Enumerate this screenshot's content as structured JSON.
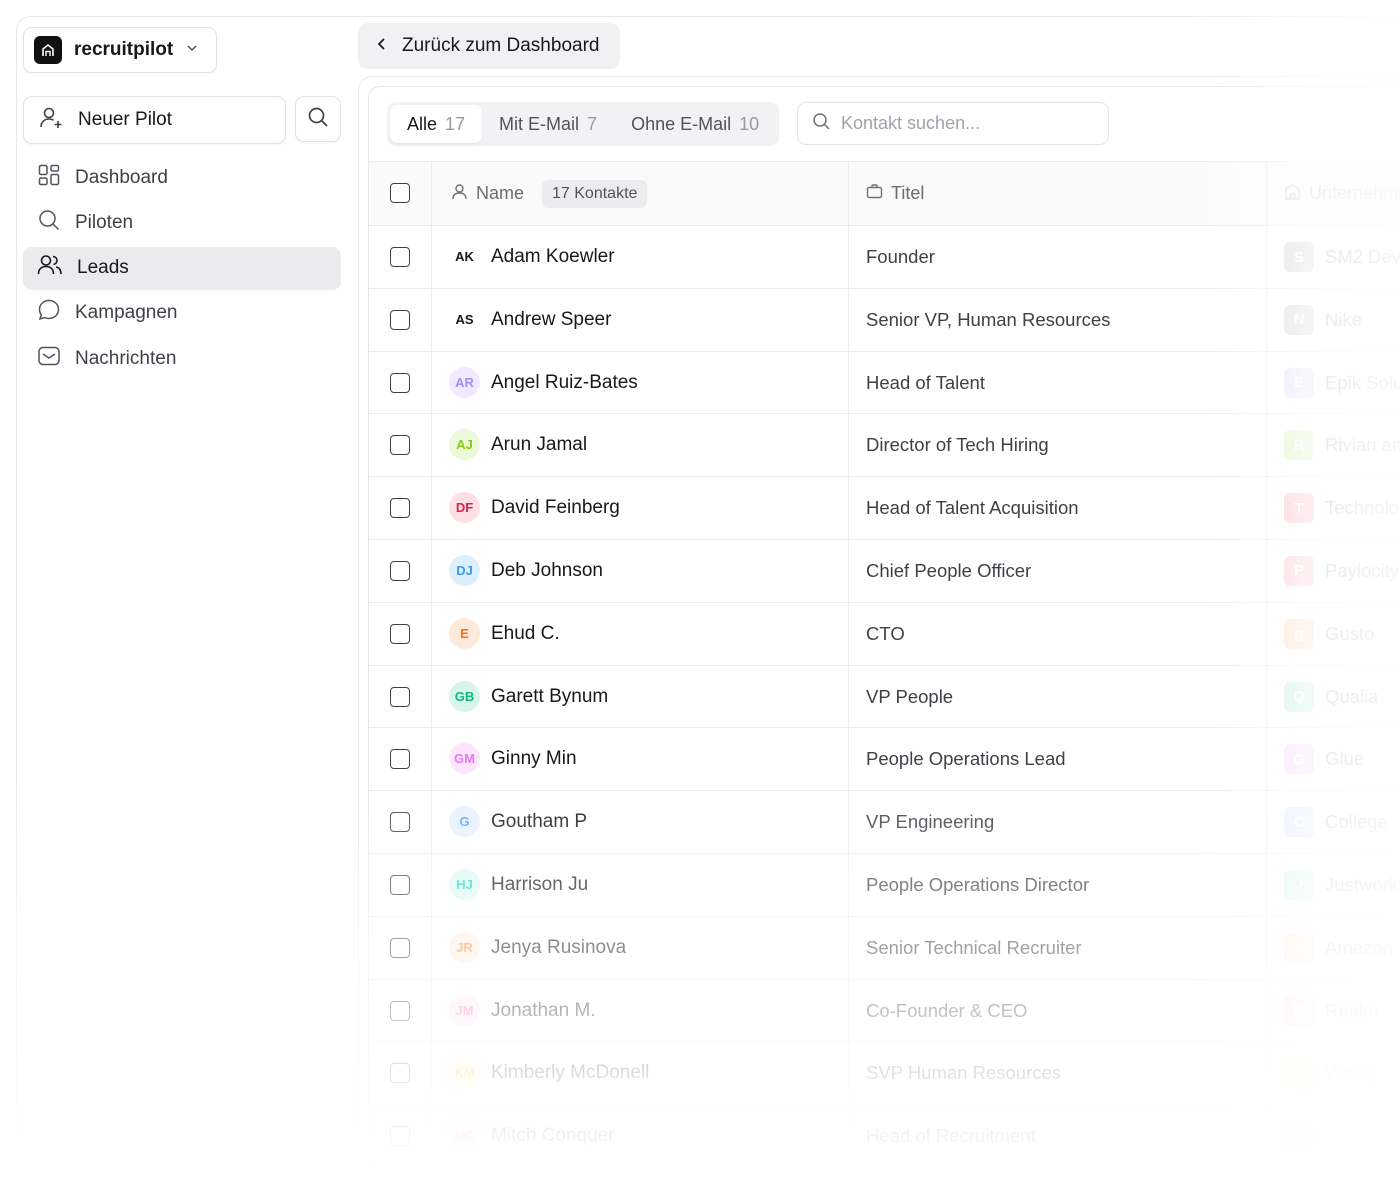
{
  "workspace": {
    "name": "recruitpilot"
  },
  "sidebar": {
    "new_pilot_label": "Neuer Pilot",
    "items": [
      {
        "label": "Dashboard",
        "icon": "grid-icon",
        "active": false
      },
      {
        "label": "Piloten",
        "icon": "search-icon",
        "active": false
      },
      {
        "label": "Leads",
        "icon": "users-icon",
        "active": true
      },
      {
        "label": "Kampagnen",
        "icon": "chat-bubble-icon",
        "active": false
      },
      {
        "label": "Nachrichten",
        "icon": "inbox-icon",
        "active": false
      }
    ]
  },
  "back_button": {
    "label": "Zurück zum Dashboard"
  },
  "filters": {
    "tabs": [
      {
        "label": "Alle",
        "count": "17",
        "active": true
      },
      {
        "label": "Mit E-Mail",
        "count": "7",
        "active": false
      },
      {
        "label": "Ohne E-Mail",
        "count": "10",
        "active": false
      }
    ],
    "search_placeholder": "Kontakt suchen..."
  },
  "table": {
    "columns": {
      "name": "Name",
      "name_badge": "17 Kontakte",
      "title": "Titel",
      "company": "Unternehmen"
    },
    "rows": [
      {
        "initials": "AK",
        "name": "Adam Koewler",
        "title": "Founder",
        "company_initial": "S",
        "company": "SM2 Dev",
        "color": "#18181b",
        "bg": "#ffffff",
        "ccolor": "#d4d4d8"
      },
      {
        "initials": "AS",
        "name": "Andrew Speer",
        "title": "Senior VP, Human Resources",
        "company_initial": "N",
        "company": "Nike",
        "color": "#18181b",
        "bg": "#ffffff",
        "ccolor": "#d4d4d8"
      },
      {
        "initials": "AR",
        "name": "Angel Ruiz-Bates",
        "title": "Head of Talent",
        "company_initial": "E",
        "company": "Epik Solutions",
        "color": "#a78bfa",
        "bg": "#efeafe",
        "ccolor": "#e4dcfd"
      },
      {
        "initials": "AJ",
        "name": "Arun Jamal",
        "title": "Director of Tech Hiring",
        "company_initial": "R",
        "company": "Rivian and",
        "color": "#84cc16",
        "bg": "#eef9dc",
        "ccolor": "#d9f2b8"
      },
      {
        "initials": "DF",
        "name": "David Feinberg",
        "title": "Head of Talent Acquisition",
        "company_initial": "T",
        "company": "Technology",
        "color": "#e11d48",
        "bg": "#fde0e6",
        "ccolor": "#fbb6c4"
      },
      {
        "initials": "DJ",
        "name": "Deb Johnson",
        "title": "Chief People Officer",
        "company_initial": "P",
        "company": "Paylocity",
        "color": "#3b9be6",
        "bg": "#ddeefc",
        "ccolor": "#fbc4cf"
      },
      {
        "initials": "E",
        "name": "Ehud C.",
        "title": "CTO",
        "company_initial": "g",
        "company": "Gusto",
        "color": "#f97316",
        "bg": "#feeadb",
        "ccolor": "#fdd9bf"
      },
      {
        "initials": "GB",
        "name": "Garett Bynum",
        "title": "VP People",
        "company_initial": "Q",
        "company": "Qualia",
        "color": "#10b981",
        "bg": "#d8f5ea",
        "ccolor": "#bfeedd"
      },
      {
        "initials": "GM",
        "name": "Ginny Min",
        "title": "People Operations Lead",
        "company_initial": "G",
        "company": "Glue",
        "color": "#e879f9",
        "bg": "#fbe6fd",
        "ccolor": "#f8d4fb"
      },
      {
        "initials": "G",
        "name": "Goutham P",
        "title": "VP Engineering",
        "company_initial": "C",
        "company": "College",
        "color": "#60a5fa",
        "bg": "#e6f0fd",
        "ccolor": "#d3e5fc"
      },
      {
        "initials": "HJ",
        "name": "Harrison Ju",
        "title": "People Operations Director",
        "company_initial": "J",
        "company": "Justworks",
        "color": "#2dd4bf",
        "bg": "#ddf8f3",
        "ccolor": "#c6f3ea"
      },
      {
        "initials": "JR",
        "name": "Jenya Rusinova",
        "title": "Senior Technical Recruiter",
        "company_initial": "A",
        "company": "Amazon",
        "color": "#fb923c",
        "bg": "#feeee0",
        "ccolor": "#fde0c8"
      },
      {
        "initials": "JM",
        "name": "Jonathan M.",
        "title": "Co-Founder & CEO",
        "company_initial": "R",
        "company": "Realm",
        "color": "#f472b6",
        "bg": "#fde8f3",
        "ccolor": "#fbd4e8"
      },
      {
        "initials": "KM",
        "name": "Kimberly McDonell",
        "title": "SVP Human Resources",
        "company_initial": "W",
        "company": "Warby",
        "color": "#facc15",
        "bg": "#fef6d4",
        "ccolor": "#fdeeb0"
      },
      {
        "initials": "MC",
        "name": "Mitch Conquer",
        "title": "Head of Recruitment",
        "company_initial": "",
        "company": "",
        "color": "#f87171",
        "bg": "#fee4e4",
        "ccolor": "#fdd5d5"
      }
    ]
  }
}
